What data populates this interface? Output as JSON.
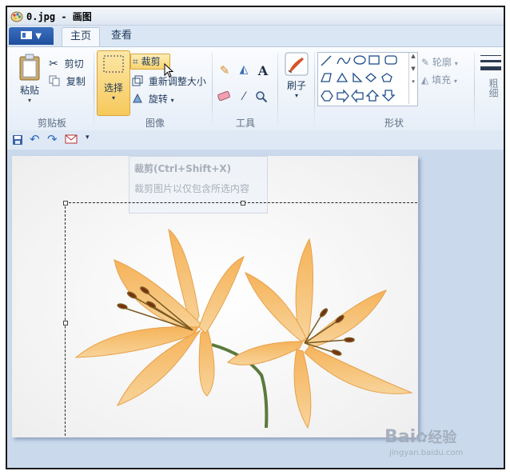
{
  "window": {
    "title": "0.jpg - 画图"
  },
  "tabs": {
    "file_label": "▼",
    "home": "主页",
    "view": "查看"
  },
  "clipboard": {
    "paste": "粘贴",
    "cut": "剪切",
    "copy": "复制",
    "label": "剪贴板"
  },
  "image": {
    "select": "选择",
    "crop": "裁剪",
    "resize": "重新调整大小",
    "rotate": "旋转",
    "label": "图像"
  },
  "tools": {
    "label": "工具"
  },
  "brushes": {
    "label": "刷子"
  },
  "shapes": {
    "outline": "轮廓",
    "fill": "填充",
    "label": "形状"
  },
  "size": {
    "label": "粗细"
  },
  "tooltip": {
    "title": "裁剪(Ctrl+Shift+X)",
    "desc": "裁剪图片以仅包含所选内容"
  },
  "watermark": {
    "brand": "Bai",
    "brand2": "经验",
    "url": "jingyan.baidu.com"
  },
  "colors": {
    "accent": "#fbd97c",
    "titlebar": "#dde6f1",
    "canvas_bg": "#cad9ec"
  }
}
